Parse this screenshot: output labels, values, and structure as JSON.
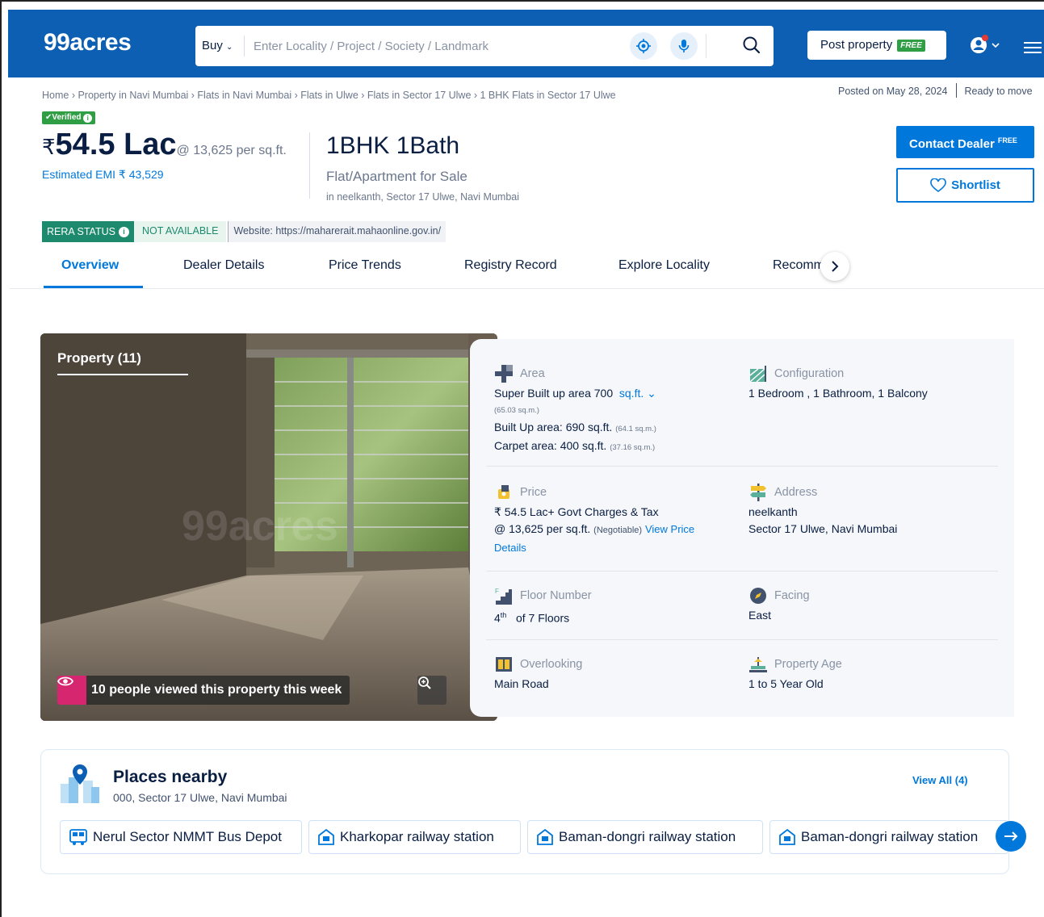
{
  "header": {
    "logo": "99acres",
    "buy_label": "Buy",
    "search_placeholder": "Enter Locality / Project / Society / Landmark",
    "post_property_label": "Post property",
    "post_property_tag": "FREE"
  },
  "breadcrumb": "Home › Property in Navi Mumbai › Flats in Navi Mumbai › Flats in Ulwe › Flats in Sector 17 Ulwe › 1 BHK Flats in Sector 17 Ulwe",
  "posted": {
    "date": "Posted on May 28, 2024",
    "status": "Ready to move"
  },
  "listing": {
    "verified_label": "✔Verified",
    "rupee": "₹",
    "price": "54.5 Lac",
    "price_per": "@ 13,625 per sq.ft.",
    "emi": "Estimated EMI ₹ 43,529",
    "bhk": "1BHK 1Bath",
    "type": "Flat/Apartment for Sale",
    "location": "in neelkanth, Sector 17 Ulwe, Navi Mumbai"
  },
  "actions": {
    "contact_label": "Contact Dealer",
    "contact_tag": "FREE",
    "shortlist_label": "Shortlist"
  },
  "rera": {
    "label": "RERA STATUS",
    "status": "NOT AVAILABLE",
    "website": "Website: https://maharerait.mahaonline.gov.in/"
  },
  "tabs": [
    "Overview",
    "Dealer Details",
    "Price Trends",
    "Registry Record",
    "Explore Locality",
    "Recomm"
  ],
  "photo": {
    "title": "Property (11)",
    "watermark": "99acres",
    "viewed_text": "10 people viewed this property this week"
  },
  "details": {
    "area": {
      "title": "Area",
      "super_built": "Super Built up area 700",
      "unit": "sq.ft.",
      "super_sqm": "(65.03 sq.m.)",
      "built_up": "Built Up area: 690 sq.ft.",
      "built_up_sqm": "(64.1 sq.m.)",
      "carpet": "Carpet area: 400 sq.ft.",
      "carpet_sqm": "(37.16 sq.m.)"
    },
    "configuration": {
      "title": "Configuration",
      "value": "1 Bedroom , 1 Bathroom, 1 Balcony"
    },
    "price": {
      "title": "Price",
      "line1": "₹ 54.5 Lac+ Govt Charges & Tax",
      "line2": "@ 13,625 per sq.ft.",
      "negotiable": "(Negotiable)",
      "view_link": "View Price",
      "details_link": "Details"
    },
    "address": {
      "title": "Address",
      "line1": "neelkanth",
      "line2": "Sector 17 Ulwe, Navi Mumbai"
    },
    "floor": {
      "title": "Floor Number",
      "floor": "4",
      "suffix": "th",
      "of": "of 7 Floors"
    },
    "facing": {
      "title": "Facing",
      "value": "East"
    },
    "overlooking": {
      "title": "Overlooking",
      "value": "Main Road"
    },
    "age": {
      "title": "Property Age",
      "value": "1 to 5 Year Old"
    }
  },
  "places": {
    "title": "Places nearby",
    "subtitle": "000, Sector 17 Ulwe, Navi Mumbai",
    "view_all": "View All (4)",
    "items": [
      {
        "label": "Nerul Sector NMMT Bus Depot",
        "icon": "bus-icon"
      },
      {
        "label": "Kharkopar railway station",
        "icon": "station-icon"
      },
      {
        "label": "Baman-dongri railway station",
        "icon": "station-icon"
      },
      {
        "label": "Baman-dongri railway station",
        "icon": "station-icon"
      }
    ]
  },
  "colors": {
    "brand_blue": "#0d5fb3",
    "link_blue": "#0078db",
    "rera_green": "#1d8a6e",
    "viewed_pink": "#d6266f"
  }
}
